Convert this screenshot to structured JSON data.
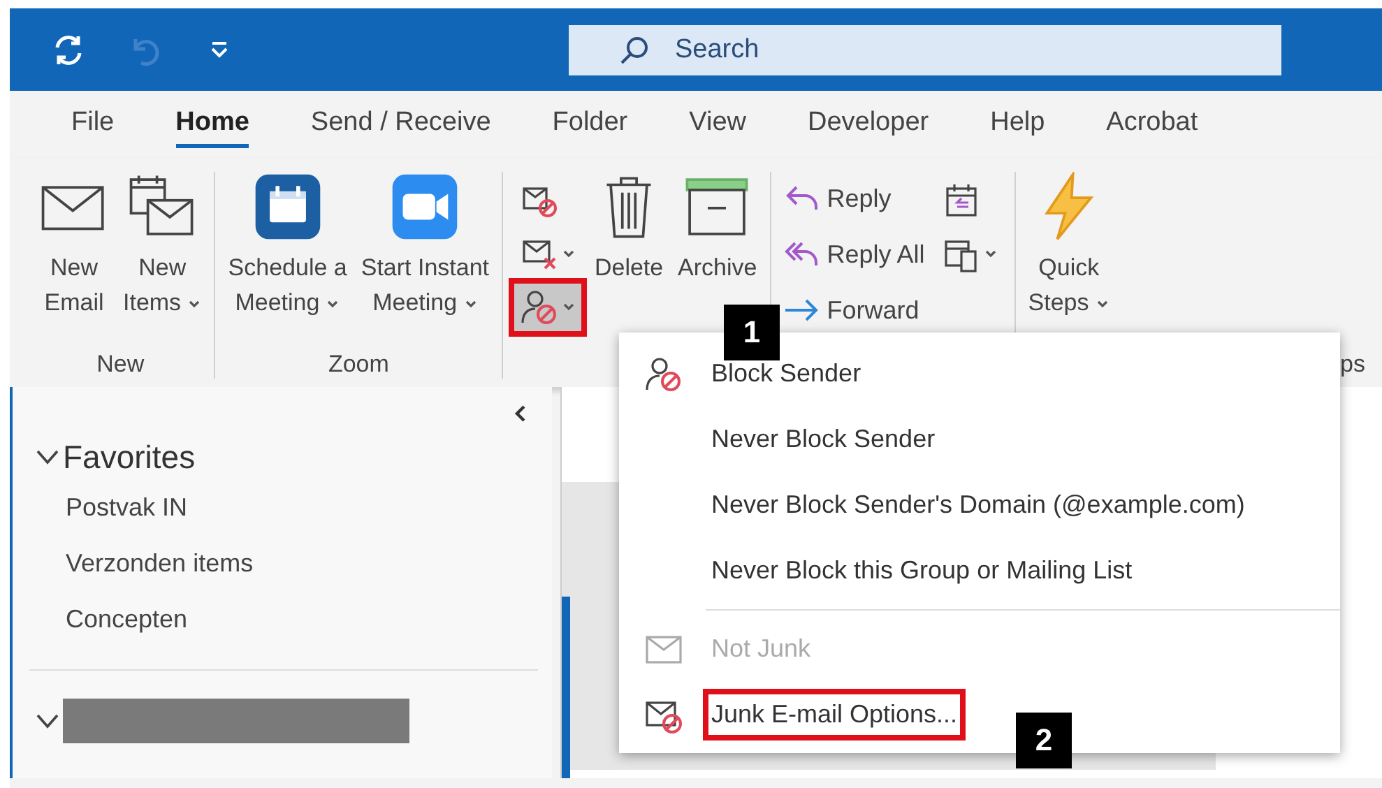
{
  "title_bar": {
    "search": {
      "placeholder": "Search"
    }
  },
  "tabs": [
    {
      "label": "File",
      "selected": false
    },
    {
      "label": "Home",
      "selected": true
    },
    {
      "label": "Send / Receive",
      "selected": false
    },
    {
      "label": "Folder",
      "selected": false
    },
    {
      "label": "View",
      "selected": false
    },
    {
      "label": "Developer",
      "selected": false
    },
    {
      "label": "Help",
      "selected": false
    },
    {
      "label": "Acrobat",
      "selected": false
    }
  ],
  "ribbon": {
    "groups": [
      {
        "label": "New",
        "buttons": [
          {
            "kind": "mail",
            "lines": [
              "New",
              "Email"
            ],
            "dropdown": false
          },
          {
            "kind": "items",
            "lines": [
              "New",
              "Items"
            ],
            "dropdown": true
          }
        ]
      },
      {
        "label": "Zoom",
        "buttons": [
          {
            "kind": "calendar",
            "lines": [
              "Schedule a",
              "Meeting"
            ],
            "dropdown": true
          },
          {
            "kind": "video",
            "lines": [
              "Start Instant",
              "Meeting"
            ],
            "dropdown": true
          }
        ]
      },
      {
        "small": [
          {
            "kind": "ignore",
            "dropdown": false,
            "pressed": false,
            "highlighted": false
          },
          {
            "kind": "clean",
            "dropdown": true,
            "pressed": false,
            "highlighted": false
          },
          {
            "kind": "junk",
            "dropdown": true,
            "pressed": true,
            "highlighted": true
          }
        ],
        "buttons": [
          {
            "kind": "trash",
            "lines": [
              "Delete"
            ],
            "dropdown": false
          },
          {
            "kind": "archive",
            "lines": [
              "Archive"
            ],
            "dropdown": false
          }
        ]
      },
      {
        "respond": [
          {
            "kind": "reply",
            "text": "Reply"
          },
          {
            "kind": "replyall",
            "text": "Reply All"
          },
          {
            "kind": "forward",
            "text": "Forward"
          }
        ],
        "small": [
          {
            "kind": "meeting",
            "dropdown": false,
            "pressed": false,
            "highlighted": false
          },
          {
            "kind": "more",
            "dropdown": true,
            "pressed": false,
            "highlighted": false
          }
        ]
      },
      {
        "label": "ps",
        "buttons": [
          {
            "kind": "bolt",
            "lines": [
              "Quick",
              "Steps"
            ],
            "dropdown": true
          }
        ]
      }
    ]
  },
  "junk_menu": {
    "items": [
      {
        "kind": "block",
        "label": "Block Sender",
        "disabled": false,
        "highlighted": false
      },
      {
        "kind": "plain",
        "label": "Never Block Sender",
        "disabled": false,
        "highlighted": false
      },
      {
        "kind": "plain",
        "label": "Never Block Sender's Domain (@example.com)",
        "disabled": false,
        "highlighted": false
      },
      {
        "kind": "plain",
        "label": "Never Block this Group or Mailing List",
        "disabled": false,
        "highlighted": false
      },
      {
        "kind": "separator"
      },
      {
        "kind": "notjunk",
        "label": "Not Junk",
        "disabled": true,
        "highlighted": false
      },
      {
        "kind": "options",
        "label": "Junk E-mail Options...",
        "disabled": false,
        "highlighted": true
      }
    ]
  },
  "annotations": [
    {
      "label": "1"
    },
    {
      "label": "2"
    }
  ],
  "folder_pane": {
    "sections": [
      {
        "title": "Favorites",
        "expanded": true,
        "redacted": false,
        "items": [
          "Postvak IN",
          "Verzonden items",
          "Concepten"
        ]
      },
      {
        "expanded": true,
        "redacted": true
      }
    ]
  }
}
